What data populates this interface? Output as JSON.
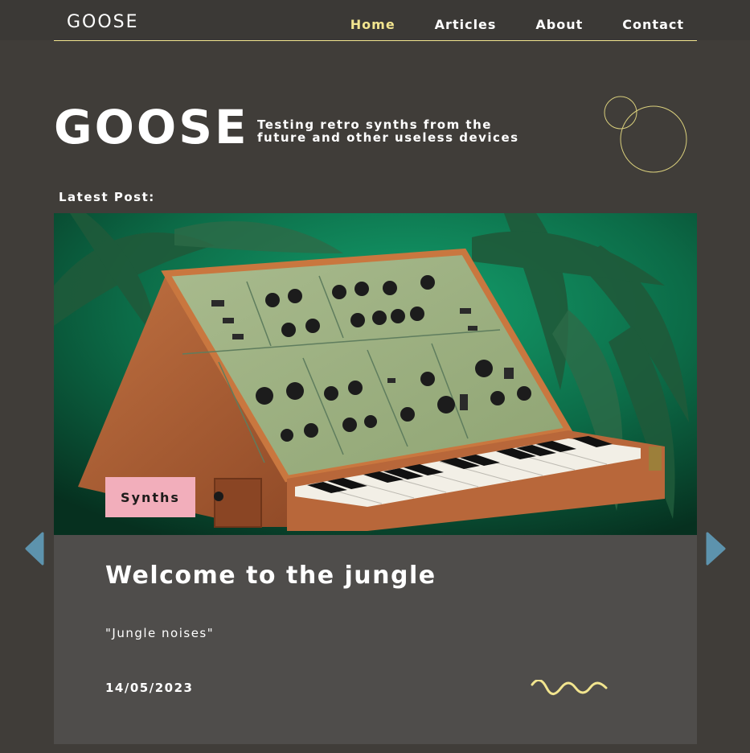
{
  "nav": {
    "brand": "GOOSE",
    "links": [
      {
        "label": "Home",
        "active": true
      },
      {
        "label": "Articles",
        "active": false
      },
      {
        "label": "About",
        "active": false
      },
      {
        "label": "Contact",
        "active": false
      }
    ]
  },
  "hero": {
    "title": "GOOSE",
    "tagline": "Testing retro synths from the future and other useless devices"
  },
  "latest_label": "Latest Post:",
  "post": {
    "tag": "Synths",
    "title": "Welcome to the jungle",
    "excerpt": "\"Jungle noises\"",
    "date": "14/05/2023"
  },
  "colors": {
    "background": "#403d39",
    "accent_yellow": "#f2e58f",
    "tag_pink": "#f2aebb",
    "card_body": "#4f4d4b",
    "arrow_blue": "#5d93ad"
  },
  "icons": {
    "prev": "triangle-left-icon",
    "next": "triangle-right-icon",
    "decor_circles": "circles-icon",
    "decor_wave": "squiggle-icon"
  }
}
